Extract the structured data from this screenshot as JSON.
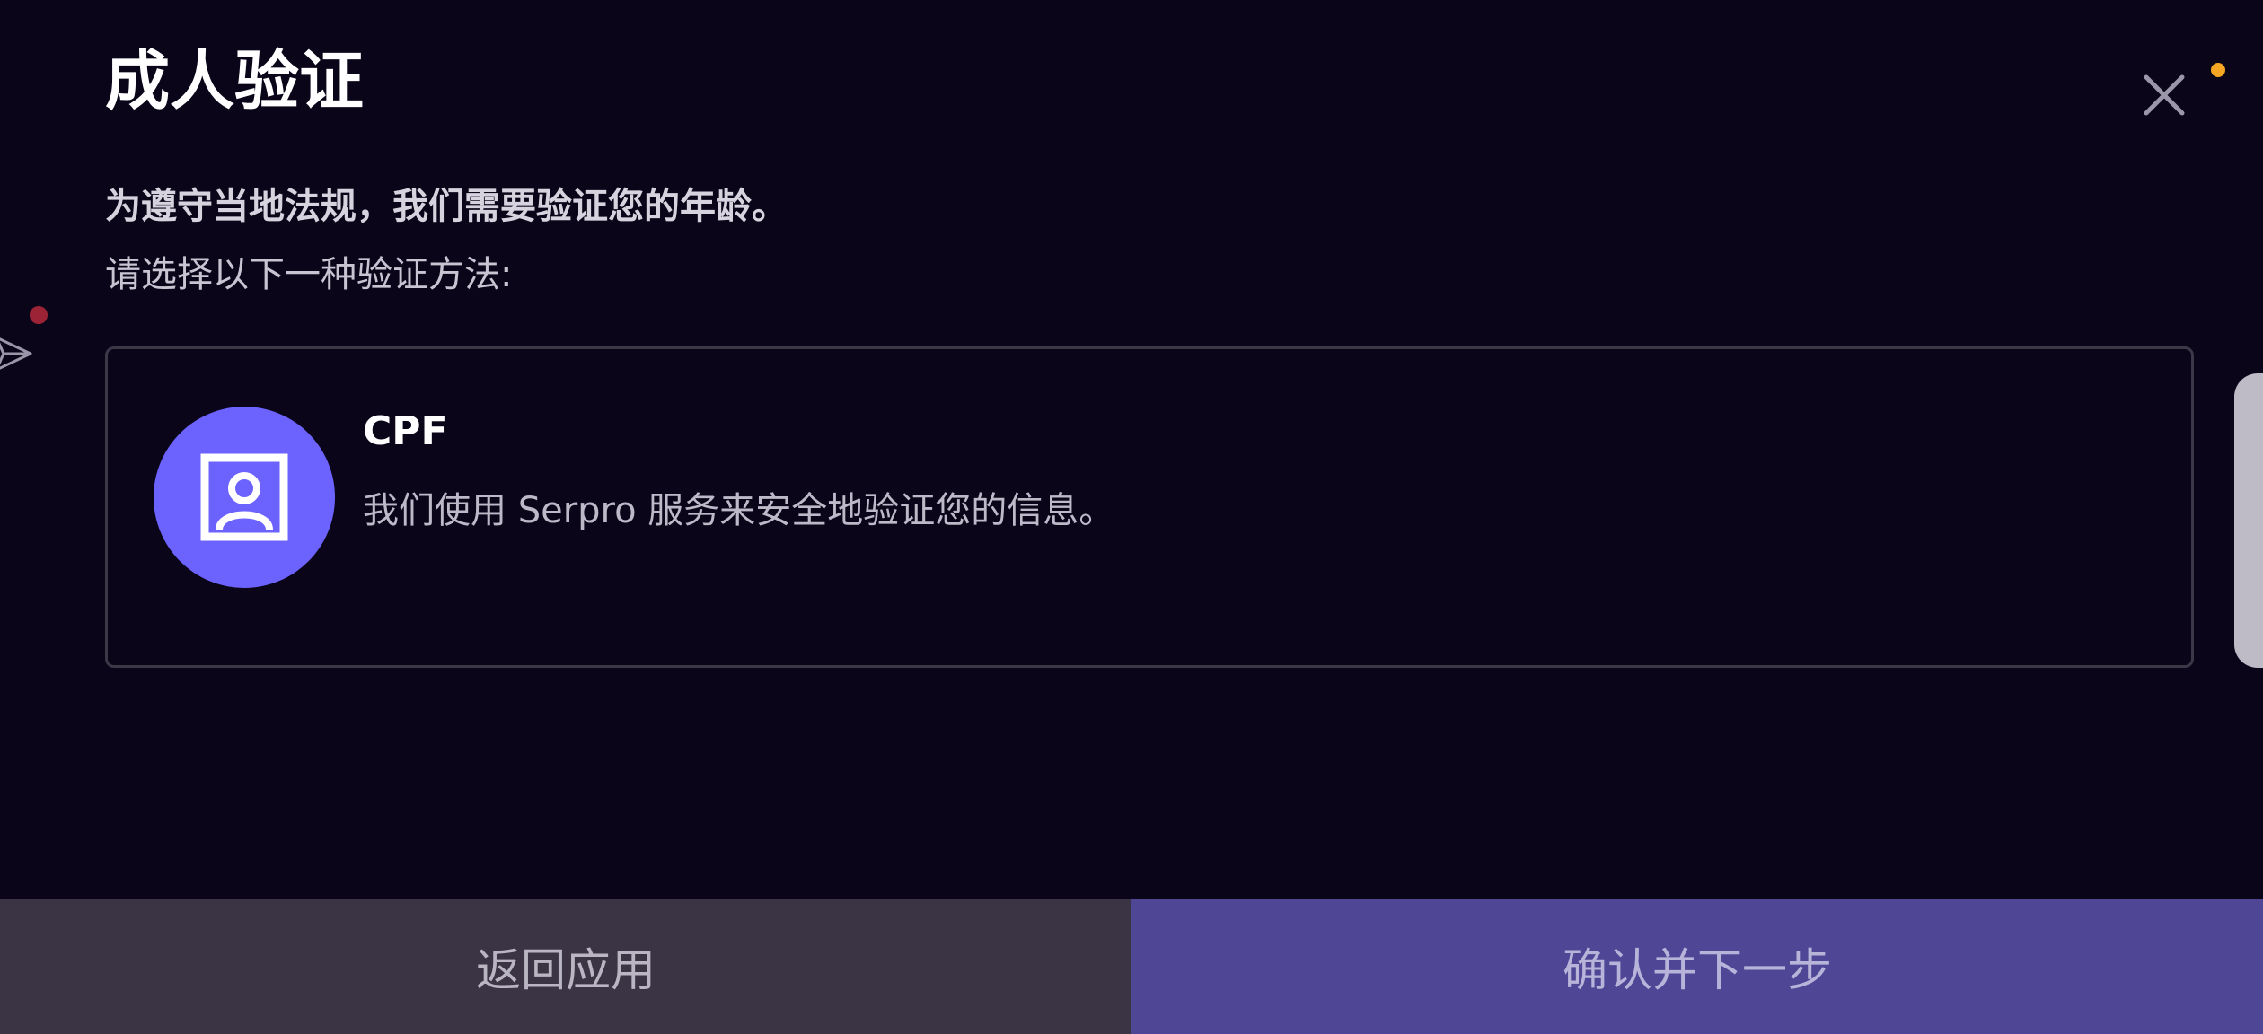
{
  "dialog": {
    "title": "成人验证",
    "subtitle": "为遵守当地法规，我们需要验证您的年龄。",
    "instruction": "请选择以下一种验证方法:"
  },
  "method": {
    "title": "CPF",
    "description": "我们使用 Serpro 服务来安全地验证您的信息。",
    "icon": "id-card-icon"
  },
  "footer": {
    "back_label": "返回应用",
    "next_label": "确认并下一步"
  },
  "colors": {
    "background": "#0a0518",
    "accent": "#6c63ff",
    "primary_button": "#4f4696",
    "secondary_button": "#3a3444",
    "notification_dot": "#f5a623"
  }
}
